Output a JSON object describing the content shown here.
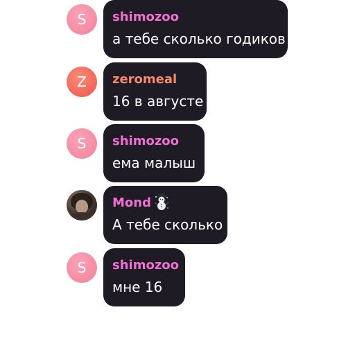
{
  "messages": [
    {
      "username": "shimozoo",
      "avatar_letter": "S",
      "text": "а тебе сколько годиков"
    },
    {
      "username": "zeromeal",
      "avatar_letter": "Z",
      "text": "16 в августе"
    },
    {
      "username": "shimozoo",
      "avatar_letter": "S",
      "text": "ема малыш"
    },
    {
      "username": "Mond",
      "badge_icon": "snowman-icon",
      "text": "А тебе сколько"
    },
    {
      "username": "shimozoo",
      "avatar_letter": "S",
      "text": "мне 16"
    }
  ],
  "colors": {
    "bubble_background": "#1f1b24",
    "username_pink": "#f06fd2",
    "username_orange": "#f78a6c",
    "avatar_pink": "#f68fa6",
    "avatar_orange": "#f26b5d",
    "message_text": "#ffffff",
    "page_background": "#ffffff"
  }
}
